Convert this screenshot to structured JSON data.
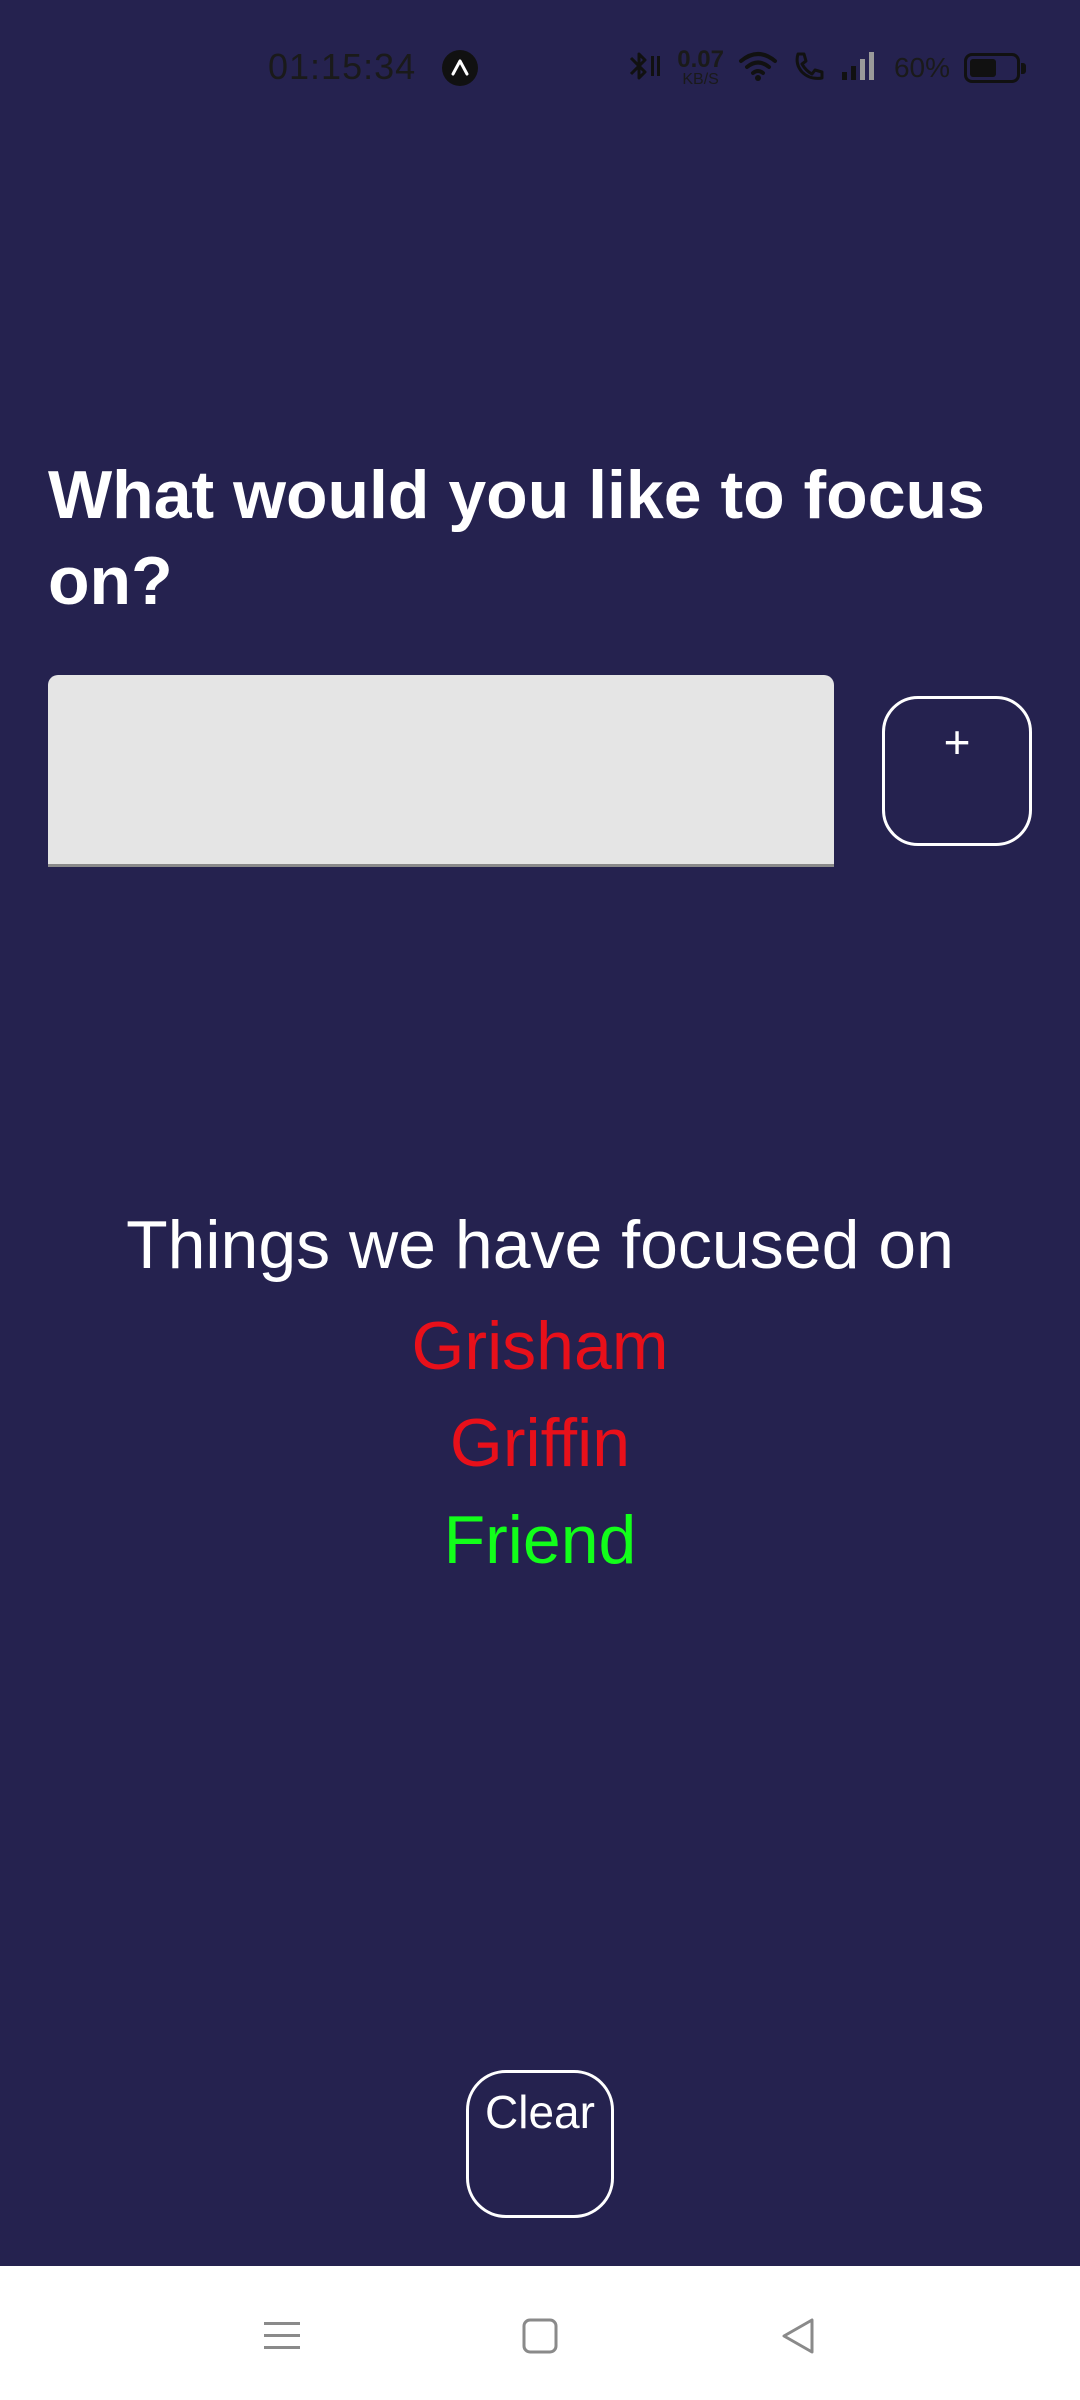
{
  "status_bar": {
    "time": "01:15:34",
    "net_speed_value": "0.07",
    "net_speed_unit": "KB/S",
    "battery_percent": "60%",
    "battery_level": 0.6,
    "icons": [
      "app-badge-icon",
      "bluetooth-icon",
      "wifi-icon",
      "call-icon",
      "signal-icon",
      "battery-icon"
    ]
  },
  "main": {
    "heading": "What would you like to focus on?",
    "input": {
      "value": "",
      "placeholder": ""
    },
    "add_label": "+"
  },
  "focus_list": {
    "title": "Things we have focused on",
    "items": [
      {
        "label": "Grisham",
        "color": "#e8101a"
      },
      {
        "label": "Griffin",
        "color": "#e8101a"
      },
      {
        "label": "Friend",
        "color": "#12ff1a"
      }
    ]
  },
  "footer": {
    "clear_label": "Clear"
  },
  "nav_bar": {
    "icons": [
      "menu-icon",
      "home-icon",
      "back-icon"
    ]
  },
  "colors": {
    "background": "#25224f",
    "text": "#ffffff",
    "input_bg": "#e5e5e5"
  }
}
